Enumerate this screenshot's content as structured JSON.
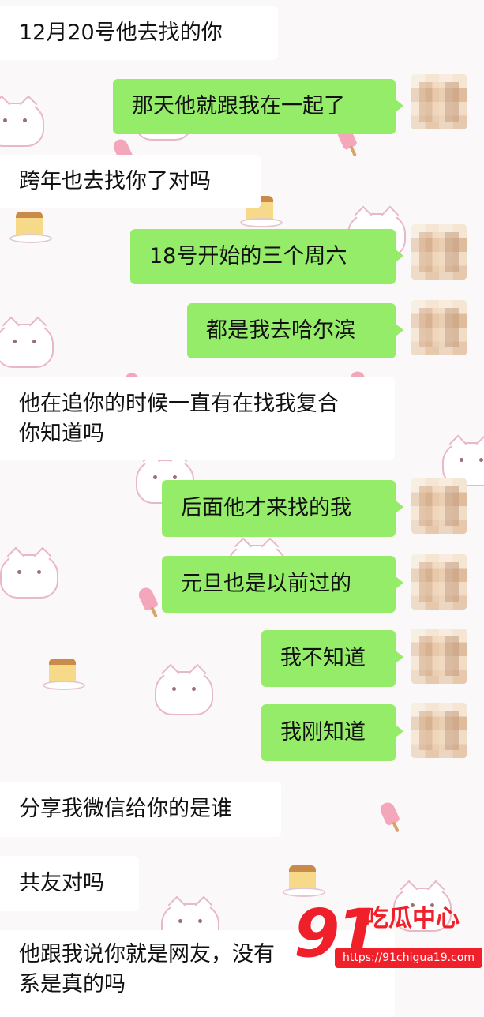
{
  "messages": [
    {
      "side": "left",
      "text": "12月20号他去找的你"
    },
    {
      "side": "right",
      "text": "那天他就跟我在一起了"
    },
    {
      "side": "left",
      "text": "跨年也去找你了对吗"
    },
    {
      "side": "right",
      "text": "18号开始的三个周六"
    },
    {
      "side": "right",
      "text": "都是我去哈尔滨"
    },
    {
      "side": "left",
      "text": "他在追你的时候一直有在找我复合",
      "text2": "你知道吗"
    },
    {
      "side": "right",
      "text": "后面他才来找的我"
    },
    {
      "side": "right",
      "text": "元旦也是以前过的"
    },
    {
      "side": "right",
      "text": "我不知道"
    },
    {
      "side": "right",
      "text": "我刚知道"
    },
    {
      "side": "left",
      "text": "分享我微信给你的是谁"
    },
    {
      "side": "left",
      "text": "共友对吗"
    },
    {
      "side": "left",
      "text": "他跟我说你就是网友，没有",
      "text2": "系是真的吗"
    }
  ],
  "watermark": {
    "number": "91",
    "title": "吃瓜中心",
    "url": "https://91chigua19.com"
  },
  "colors": {
    "right_bubble": "#95ec69",
    "left_bubble": "#ffffff",
    "background": "#fbf8f9",
    "watermark": "#f0202a"
  }
}
